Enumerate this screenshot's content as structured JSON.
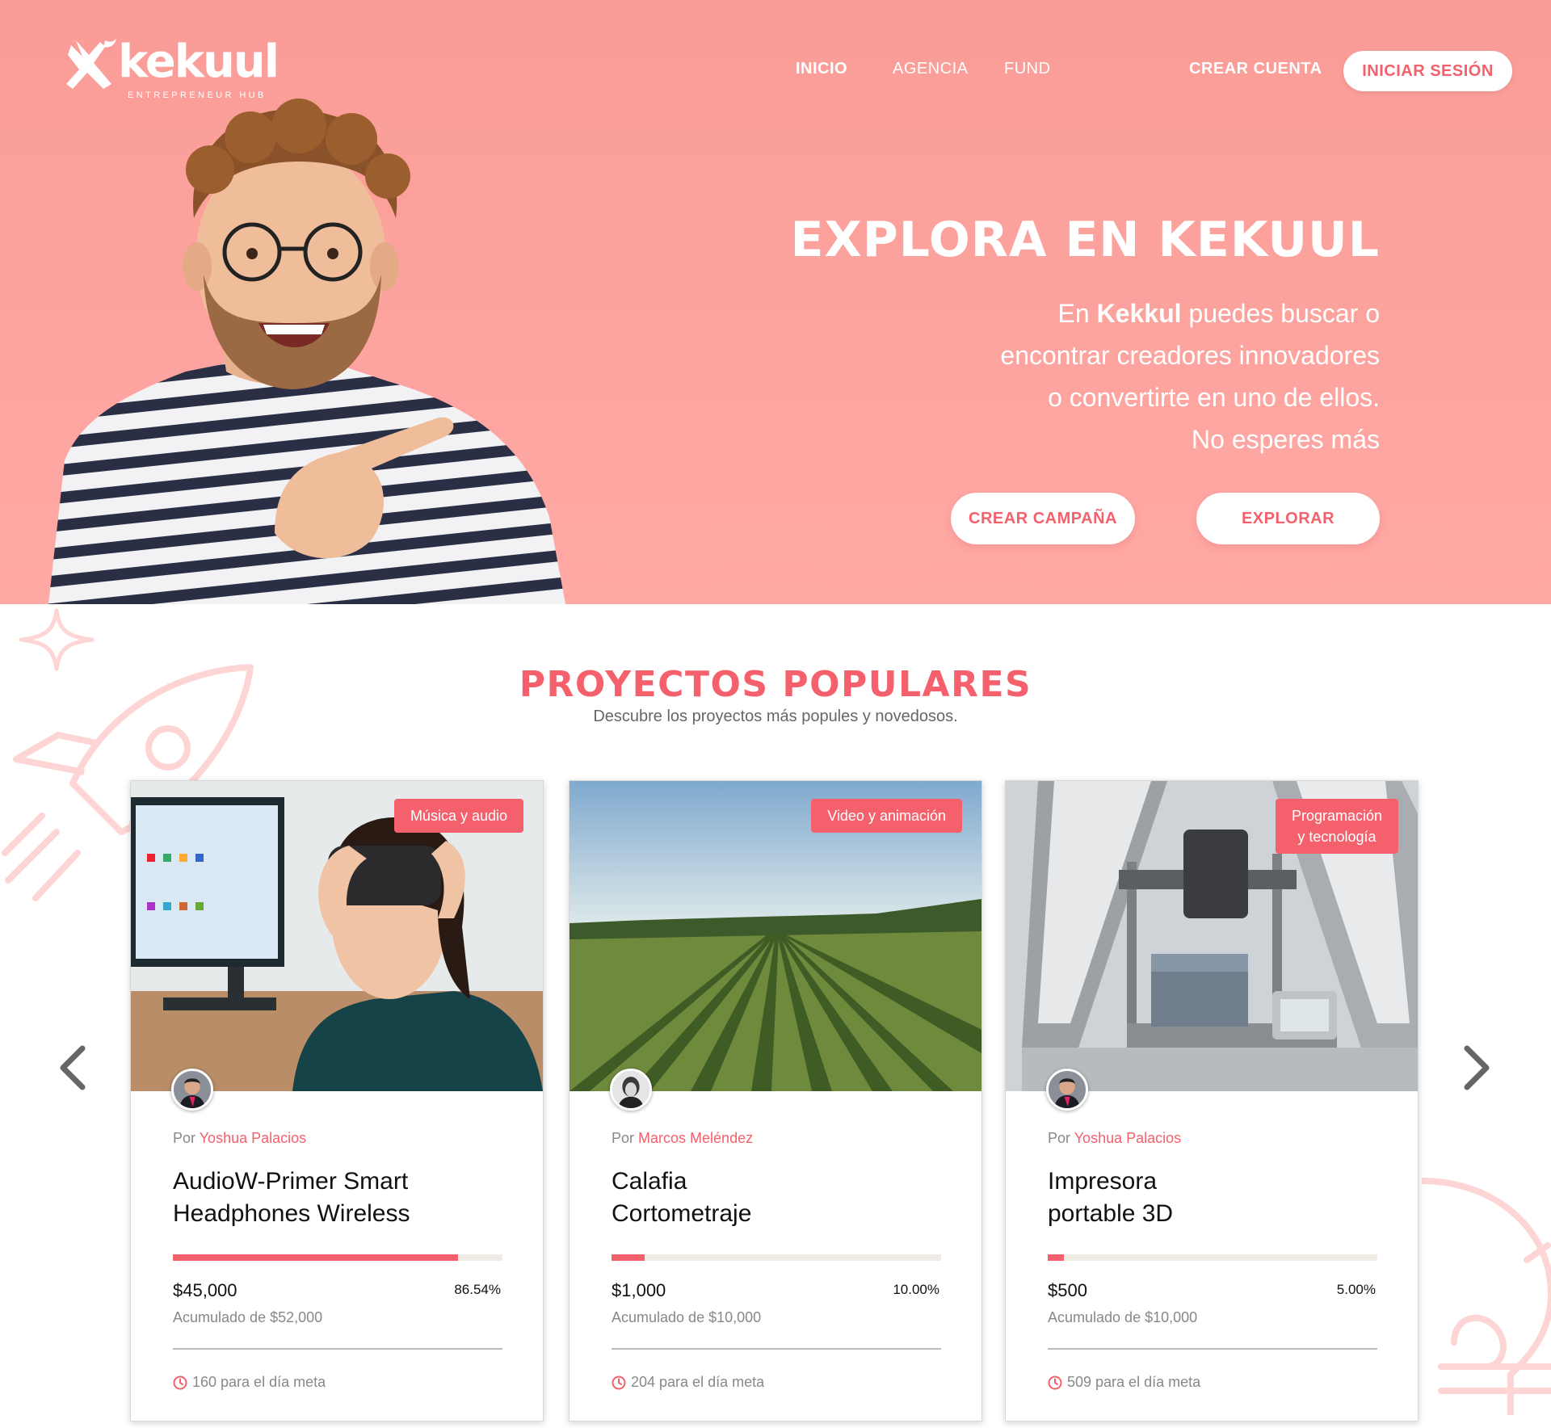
{
  "brand": {
    "name": "kekuul",
    "tagline": "ENTREPRENEUR HUB"
  },
  "nav": {
    "items": [
      "INICIO",
      "AGENCIA",
      "FUND"
    ],
    "create_account": "CREAR CUENTA",
    "login": "INICIAR SESIÓN"
  },
  "hero": {
    "title": "EXPLORA EN KEKUUL",
    "line1_prefix": "En ",
    "line1_bold": "Kekkul",
    "line1_suffix": " puedes buscar o",
    "line2": "encontrar creadores innovadores",
    "line3": "o convertirte en uno de ellos.",
    "line4": "No esperes más",
    "btn_create": "CREAR CAMPAÑA",
    "btn_explore": "EXPLORAR"
  },
  "section": {
    "title": "PROYECTOS POPULARES",
    "subtitle": "Descubre los proyectos más popules y novedosos."
  },
  "cards": [
    {
      "category_line1": "Música y audio",
      "category_line2": "",
      "by": "Por",
      "author": "Yoshua Palacios",
      "title_line1": "AudioW-Primer Smart",
      "title_line2": "Headphones Wireless",
      "progress": 0.8654,
      "amount": "$45,000",
      "percent": "86.54%",
      "goal": "Acumulado de $52,000",
      "days": "160 para el día meta"
    },
    {
      "category_line1": "Video y animación",
      "category_line2": "",
      "by": "Por",
      "author": "Marcos Meléndez",
      "title_line1": "Calafia",
      "title_line2": "Cortometraje",
      "progress": 0.1,
      "amount": "$1,000",
      "percent": "10.00%",
      "goal": "Acumulado de $10,000",
      "days": "204 para el día meta"
    },
    {
      "category_line1": "Programación",
      "category_line2": "y tecnología",
      "by": "Por",
      "author": "Yoshua Palacios",
      "title_line1": "Impresora",
      "title_line2": "portable 3D",
      "progress": 0.05,
      "amount": "$500",
      "percent": "5.00%",
      "goal": "Acumulado de $10,000",
      "days": "509 para el día meta"
    }
  ],
  "colors": {
    "accent": "#f4606c",
    "hero_bg": "#ffa9a5",
    "deco": "#fdd5d5"
  },
  "icons": [
    "kekuul-bird-logo",
    "sparkle-icon",
    "rocket-icon",
    "lightbulb-icon",
    "chevron-left-icon",
    "chevron-right-icon",
    "clock-icon"
  ]
}
